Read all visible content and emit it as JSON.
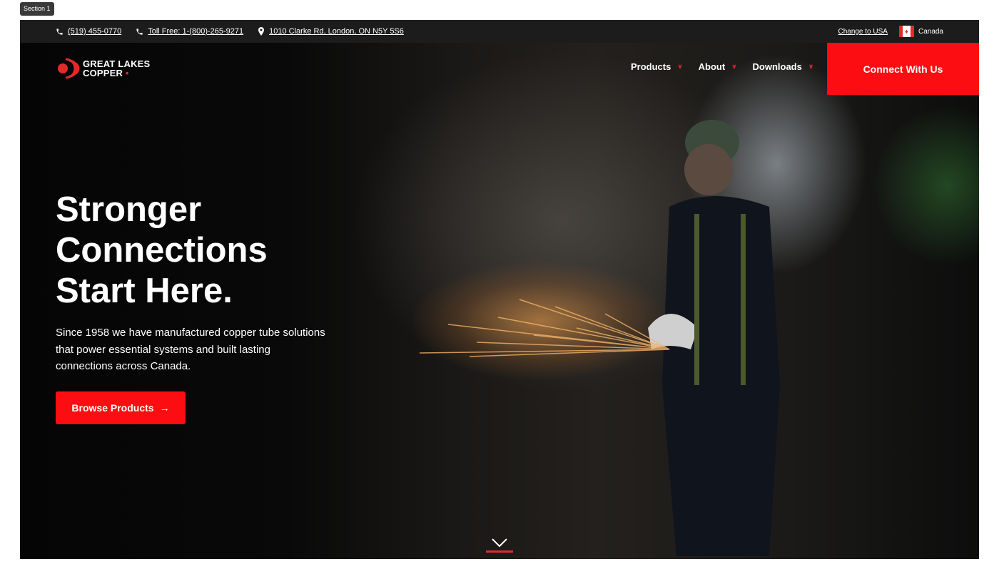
{
  "section_label": "Section 1",
  "topbar": {
    "phone": "(519) 455-0770",
    "toll_free": "Toll Free: 1-(800)-265-9271",
    "address": "1010 Clarke Rd, London, ON N5Y 5S6",
    "change_region": "Change to USA",
    "country": "Canada"
  },
  "logo": {
    "line1": "GREAT LAKES",
    "line2": "COPPER",
    "dot": "•"
  },
  "nav": {
    "items": [
      {
        "label": "Products"
      },
      {
        "label": "About"
      },
      {
        "label": "Downloads"
      }
    ],
    "cta": "Connect With Us"
  },
  "hero": {
    "headline_line1": "Stronger",
    "headline_line2": "Connections",
    "headline_line3": "Start Here.",
    "body": "Since 1958 we have manufactured copper tube solutions that power essential systems and built lasting connections across Canada.",
    "button_label": "Browse Products",
    "button_arrow": "→"
  },
  "colors": {
    "brand_red": "#fc0d12",
    "topbar_bg": "#1c1c1c"
  },
  "icons": [
    "phone-icon",
    "map-pin-icon",
    "canada-flag-icon",
    "logo-mark-icon",
    "chevron-down-icon",
    "arrow-right-icon",
    "scroll-down-chevron-icon"
  ]
}
